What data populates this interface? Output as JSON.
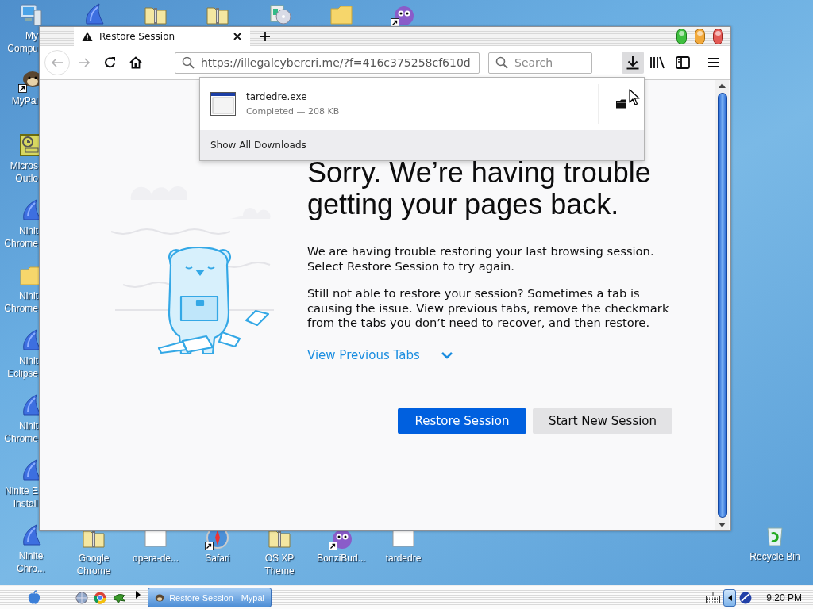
{
  "desktop": {
    "left_column": [
      {
        "kind": "computer",
        "label": [
          "My",
          "Compu"
        ],
        "shortcut": false
      },
      {
        "kind": "mypal",
        "label": [
          "MyPal"
        ],
        "shortcut": true
      },
      {
        "kind": "outlook",
        "label": [
          "Micros",
          "Outlo"
        ],
        "shortcut": false
      },
      {
        "kind": "ninite",
        "label": [
          "Ninit",
          "Chrome"
        ],
        "shortcut": false
      },
      {
        "kind": "folder",
        "label": [
          "Ninit",
          "Chrome"
        ],
        "shortcut": false
      },
      {
        "kind": "ninite",
        "label": [
          "Ninit",
          "Eclipse"
        ],
        "shortcut": false
      },
      {
        "kind": "ninite",
        "label": [
          "Ninit",
          "Chrome"
        ],
        "shortcut": false
      },
      {
        "kind": "ninite",
        "label": [
          "Ninite E",
          "Install"
        ],
        "shortcut": false
      },
      {
        "kind": "ninite",
        "label": [
          "Ninite",
          "Chro..."
        ],
        "shortcut": false
      }
    ],
    "top_row": [
      {
        "kind": "ninite",
        "shortcut": false
      },
      {
        "kind": "zip",
        "shortcut": false
      },
      {
        "kind": "zip",
        "shortcut": false
      },
      {
        "kind": "media",
        "shortcut": false
      },
      {
        "kind": "folder",
        "shortcut": false
      },
      {
        "kind": "bonzi",
        "shortcut": true
      }
    ],
    "bottom_row": [
      {
        "kind": "zip",
        "label": [
          "Google",
          "Chrome"
        ],
        "shortcut": false
      },
      {
        "kind": "blank",
        "label": [
          "opera-de..."
        ],
        "shortcut": false
      },
      {
        "kind": "safari",
        "label": [
          "Safari"
        ],
        "shortcut": true
      },
      {
        "kind": "zip",
        "label": [
          "OS XP",
          "Theme"
        ],
        "shortcut": false
      },
      {
        "kind": "bonzi",
        "label": [
          "BonziBud..."
        ],
        "shortcut": true
      },
      {
        "kind": "blank",
        "label": [
          "tardedre"
        ],
        "shortcut": false
      }
    ],
    "corner": [
      {
        "kind": "recycle",
        "label": [
          "Recycle Bin"
        ],
        "shortcut": false
      }
    ]
  },
  "browser": {
    "tabs": [
      {
        "title": "Restore Session",
        "selected": true
      }
    ],
    "toolbar": {
      "back_disabled": true,
      "forward_disabled": true,
      "url": "https://illegalcybercri.me/?f=416c375258cf610d",
      "search_placeholder": "Search",
      "downloads_open": true
    },
    "downloads_panel": {
      "items": [
        {
          "name": "tardedre.exe",
          "status": "Completed — 208 KB"
        }
      ],
      "footer": "Show All Downloads"
    },
    "page": {
      "heading": "Sorry. We’re having trouble getting your pages back.",
      "paragraphs": [
        "We are having trouble restoring your last browsing session. Select Restore Session to try again.",
        "Still not able to restore your session? Sometimes a tab is causing the issue. View previous tabs, remove the checkmark from the tabs you don’t need to recover, and then restore."
      ],
      "link": "View Previous Tabs",
      "buttons": [
        {
          "label": "Restore Session",
          "kind": "primary"
        },
        {
          "label": "Start New Session",
          "kind": "secondary"
        }
      ]
    }
  },
  "taskbar": {
    "tasks": [
      {
        "title": "Restore Session - Mypal",
        "selected": true
      }
    ],
    "clock": "9:20 PM"
  }
}
